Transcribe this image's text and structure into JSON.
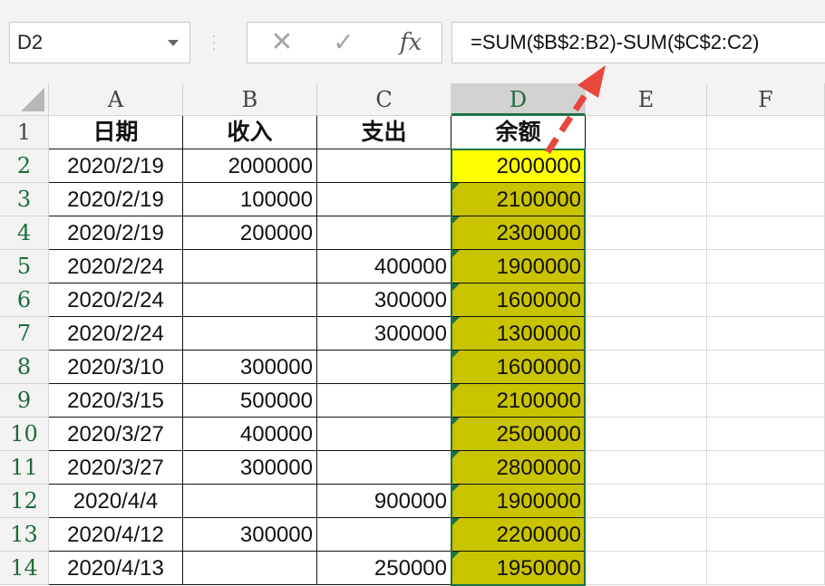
{
  "formula_bar": {
    "name_box": "D2",
    "cancel_icon": "✕",
    "enter_icon": "✓",
    "fx_label": "fx",
    "formula": "=SUM($B$2:B2)-SUM($C$2:C2)"
  },
  "columns": [
    "A",
    "B",
    "C",
    "D",
    "E",
    "F"
  ],
  "selected_column": "D",
  "header_row": {
    "number": "1",
    "date": "日期",
    "income": "收入",
    "expense": "支出",
    "balance": "余额"
  },
  "rows": [
    {
      "num": "2",
      "date": "2020/2/19",
      "income": "2000000",
      "expense": "",
      "balance": "2000000"
    },
    {
      "num": "3",
      "date": "2020/2/19",
      "income": "100000",
      "expense": "",
      "balance": "2100000"
    },
    {
      "num": "4",
      "date": "2020/2/19",
      "income": "200000",
      "expense": "",
      "balance": "2300000"
    },
    {
      "num": "5",
      "date": "2020/2/24",
      "income": "",
      "expense": "400000",
      "balance": "1900000"
    },
    {
      "num": "6",
      "date": "2020/2/24",
      "income": "",
      "expense": "300000",
      "balance": "1600000"
    },
    {
      "num": "7",
      "date": "2020/2/24",
      "income": "",
      "expense": "300000",
      "balance": "1300000"
    },
    {
      "num": "8",
      "date": "2020/3/10",
      "income": "300000",
      "expense": "",
      "balance": "1600000"
    },
    {
      "num": "9",
      "date": "2020/3/15",
      "income": "500000",
      "expense": "",
      "balance": "2100000"
    },
    {
      "num": "10",
      "date": "2020/3/27",
      "income": "400000",
      "expense": "",
      "balance": "2500000"
    },
    {
      "num": "11",
      "date": "2020/3/27",
      "income": "300000",
      "expense": "",
      "balance": "2800000"
    },
    {
      "num": "12",
      "date": "2020/4/4",
      "income": "",
      "expense": "900000",
      "balance": "1900000"
    },
    {
      "num": "13",
      "date": "2020/4/12",
      "income": "300000",
      "expense": "",
      "balance": "2200000"
    },
    {
      "num": "14",
      "date": "2020/4/13",
      "income": "",
      "expense": "250000",
      "balance": "1950000"
    }
  ],
  "colors": {
    "accent": "#1e7145",
    "active_cell": "#ffff00",
    "filled_cells": "#c9c300",
    "arrow": "#e8473e"
  }
}
